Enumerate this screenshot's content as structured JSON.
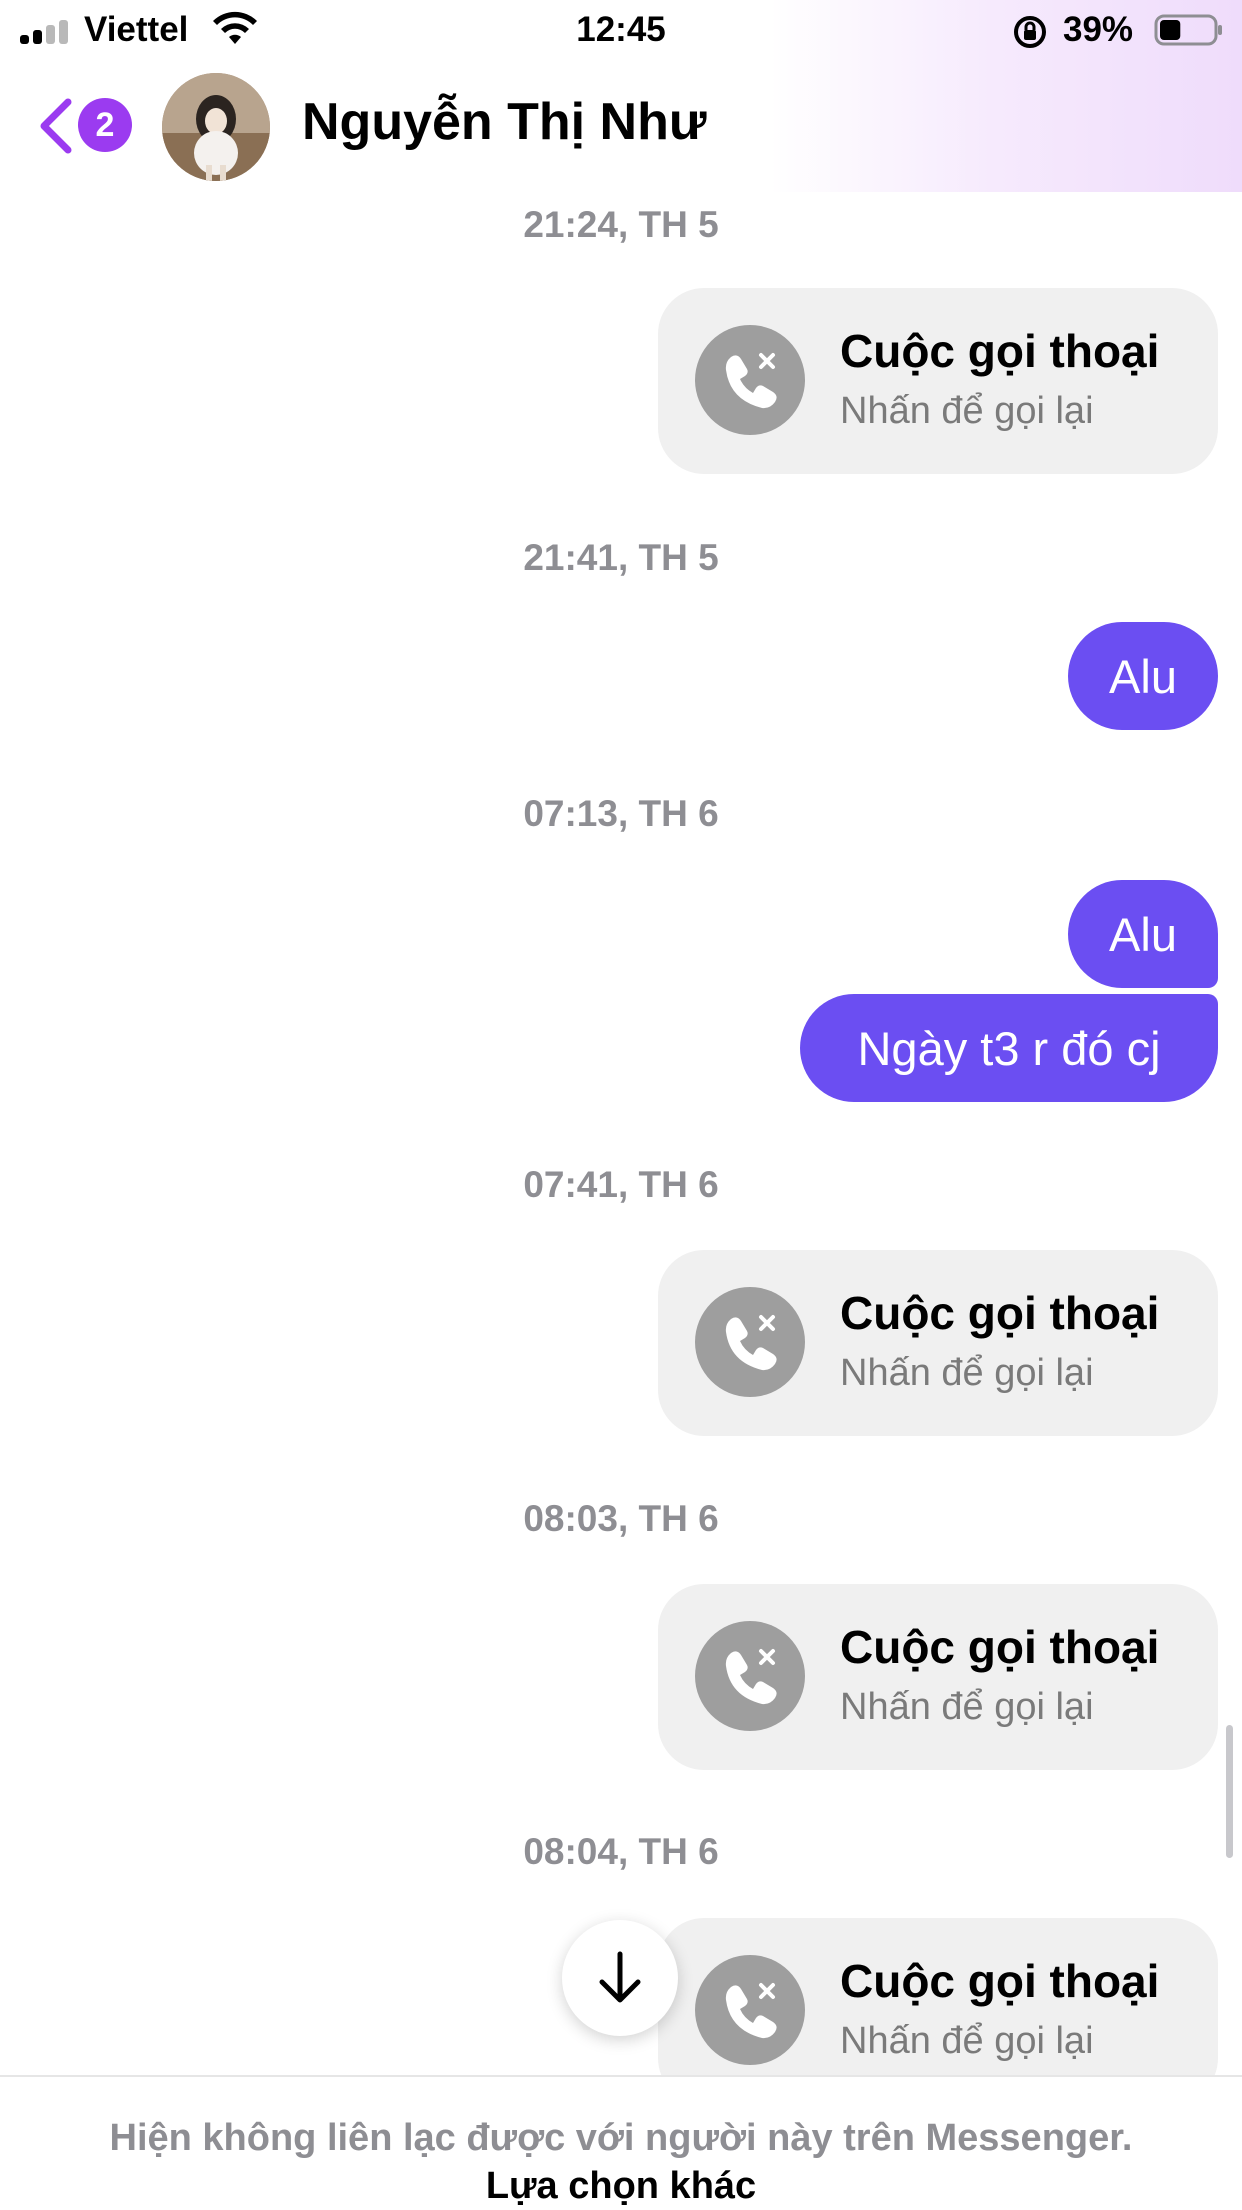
{
  "status_bar": {
    "carrier": "Viettel",
    "time": "12:45",
    "battery": "39%",
    "battery_level": 0.39
  },
  "header": {
    "back_badge": "2",
    "contact_name": "Nguyễn Thị Như"
  },
  "messages": [
    {
      "type": "timestamp",
      "text": "21:24, TH 5"
    },
    {
      "type": "call",
      "title": "Cuộc gọi thoại",
      "subtitle": "Nhấn để gọi lại"
    },
    {
      "type": "timestamp",
      "text": "21:41, TH 5"
    },
    {
      "type": "bubble",
      "text": "Alu"
    },
    {
      "type": "timestamp",
      "text": "07:13, TH 6"
    },
    {
      "type": "bubble",
      "text": "Alu"
    },
    {
      "type": "bubble",
      "text": "Ngày t3 r đó cj"
    },
    {
      "type": "timestamp",
      "text": "07:41, TH 6"
    },
    {
      "type": "call",
      "title": "Cuộc gọi thoại",
      "subtitle": "Nhấn để gọi lại"
    },
    {
      "type": "timestamp",
      "text": "08:03, TH 6"
    },
    {
      "type": "call",
      "title": "Cuộc gọi thoại",
      "subtitle": "Nhấn để gọi lại"
    },
    {
      "type": "timestamp",
      "text": "08:04, TH 6"
    },
    {
      "type": "call",
      "title": "Cuộc gọi thoại",
      "subtitle": "Nhấn để gọi lại"
    }
  ],
  "footer": {
    "notice": "Hiện không liên lạc được với người này trên Messenger.",
    "option": "Lựa chọn khác"
  },
  "colors": {
    "accent": "#9b3bf0",
    "bubble": "#6b4ef2",
    "call_bg": "#f0f0f0"
  },
  "icons": [
    "cellular-signal-icon",
    "wifi-icon",
    "rotation-lock-icon",
    "battery-icon",
    "back-chevron-icon",
    "missed-call-icon",
    "arrow-down-icon"
  ]
}
